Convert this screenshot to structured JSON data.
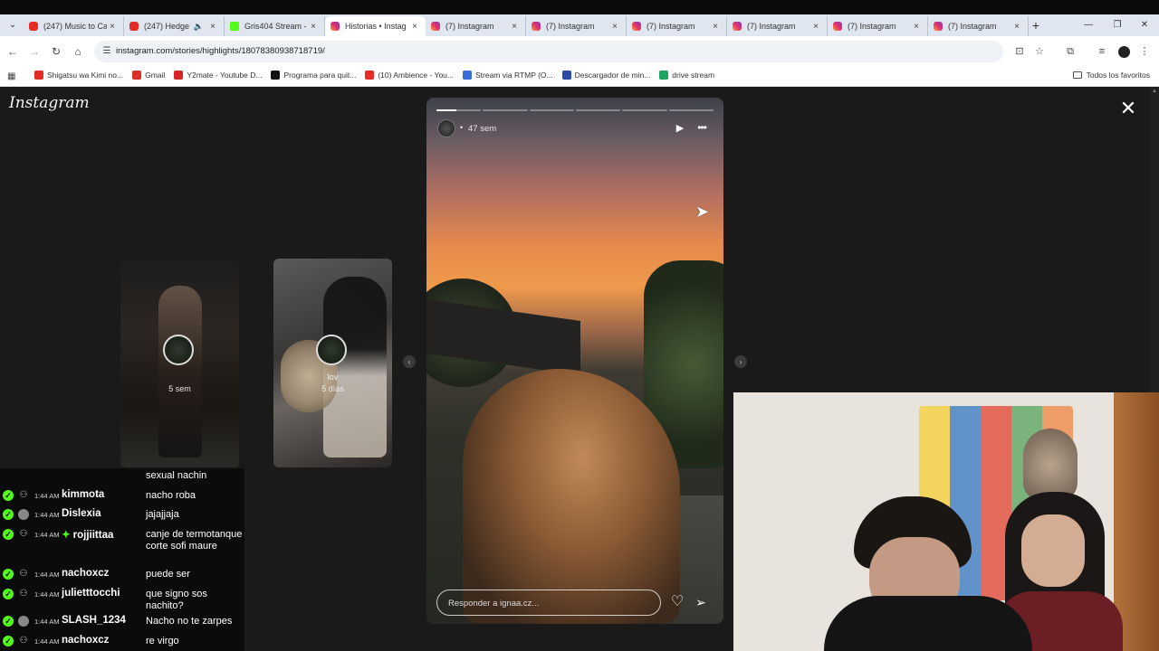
{
  "browser": {
    "tabs": [
      {
        "label": "(247) Music to Ca",
        "favicon": "youtube"
      },
      {
        "label": "(247) Hedge",
        "favicon": "youtube",
        "muted": true
      },
      {
        "label": "Gris404 Stream -",
        "favicon": "kick"
      },
      {
        "label": "Historias • Instag",
        "favicon": "instagram",
        "active": true
      },
      {
        "label": "(7) Instagram",
        "favicon": "instagram"
      },
      {
        "label": "(7) Instagram",
        "favicon": "instagram"
      },
      {
        "label": "(7) Instagram",
        "favicon": "instagram"
      },
      {
        "label": "(7) Instagram",
        "favicon": "instagram"
      },
      {
        "label": "(7) Instagram",
        "favicon": "instagram"
      },
      {
        "label": "(7) Instagram",
        "favicon": "instagram"
      }
    ],
    "url": "instagram.com/stories/highlights/18078380938718719/",
    "bookmarks": [
      {
        "label": "Shigatsu wa Kimi no...",
        "color": "#e52d27"
      },
      {
        "label": "Gmail",
        "color": "#d93025"
      },
      {
        "label": "Y2mate - Youtube D...",
        "color": "#d6252b"
      },
      {
        "label": "Programa para quit...",
        "color": "#111111"
      },
      {
        "label": "(10) Ambience - You...",
        "color": "#e52d27"
      },
      {
        "label": "Stream via RTMP (O...",
        "color": "#3a6fd8"
      },
      {
        "label": "Descargador de min...",
        "color": "#2c4aa8"
      },
      {
        "label": "drive stream",
        "color": "#1fa463"
      }
    ],
    "all_bookmarks_label": "Todos los favoritos"
  },
  "instagram": {
    "logo": "Instagram",
    "prev_stories": [
      {
        "name": "",
        "time": "5 sem"
      },
      {
        "name": "lov",
        "time": "5 días"
      }
    ],
    "story": {
      "time": "47 sem",
      "segments": 6,
      "current_segment": 0,
      "current_progress": 0.45,
      "reply_placeholder": "Responder a ignaa.cz..."
    }
  },
  "chat": {
    "fragment": "sexual nachin",
    "messages": [
      {
        "time": "1:44 AM",
        "user": "kimmota",
        "text": "nacho roba"
      },
      {
        "time": "1:44 AM",
        "user": "Dislexia",
        "text": "jajajjaja",
        "avatar": true
      },
      {
        "time": "1:44 AM",
        "user": "rojjiittaa",
        "text": "canje de termotanque corte sofi maure",
        "spark": true
      },
      {
        "time": "1:44 AM",
        "user": "nachoxcz",
        "text": "puede ser"
      },
      {
        "time": "1:44 AM",
        "user": "julietttocchi",
        "text": "que signo sos nachito?"
      },
      {
        "time": "1:44 AM",
        "user": "SLASH_1234",
        "text": "Nacho no te zarpes",
        "avatar": true
      },
      {
        "time": "1:44 AM",
        "user": "nachoxcz",
        "text": "re virgo"
      }
    ]
  }
}
